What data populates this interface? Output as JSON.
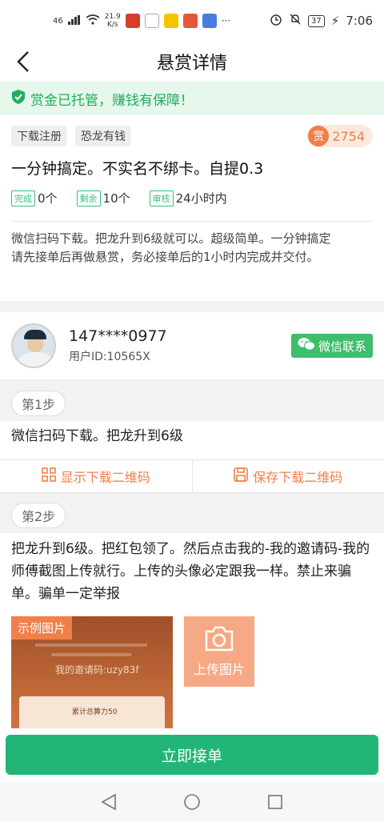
{
  "status_bar": {
    "signal": "46",
    "speed_value": "21.9",
    "speed_unit": "K/s",
    "more": "···",
    "battery": "37",
    "time": "7:06"
  },
  "header": {
    "title": "悬赏详情"
  },
  "banner": {
    "text": "赏金已托管，赚钱有保障！"
  },
  "task": {
    "tags": [
      "下载注册",
      "恐龙有钱"
    ],
    "reward_icon": "赏",
    "reward_amount": "2754",
    "title": "一分钟搞定。不实名不绑卡。自提0.3",
    "stats": {
      "done_label": "完成",
      "done_value": "0个",
      "remaining_label": "剩余",
      "remaining_value": "10个",
      "review_label": "审核",
      "review_value": "24小时内"
    },
    "description_1": "微信扫码下载。把龙升到6级就可以。超级简单。一分钟搞定",
    "description_2": "请先接单后再做悬赏，务必接单后的1小时内完成并交付。"
  },
  "publisher": {
    "phone": "147****0977",
    "user_id": "用户ID:10565X",
    "contact_label": "微信联系"
  },
  "steps": [
    {
      "label": "第1步",
      "text": "微信扫码下载。把龙升到6级"
    },
    {
      "label": "第2步",
      "text": "把龙升到6级。把红包领了。然后点击我的-我的邀请码-我的师傅截图上传就行。上传的头像必定跟我一样。禁止来骗单。骗单一定举报"
    }
  ],
  "qr_actions": {
    "show_label": "显示下载二维码",
    "save_label": "保存下载二维码"
  },
  "images": {
    "example_label": "示例图片",
    "example_invite_text": "我的邀请码:uzy83f",
    "example_card_text": "累计总算力50",
    "upload_label": "上传图片"
  },
  "accept_button": "立即接单",
  "colors": {
    "brand_green": "#22b578",
    "accent_orange": "#f07f4a",
    "banner_bg": "#e6f7ec"
  }
}
